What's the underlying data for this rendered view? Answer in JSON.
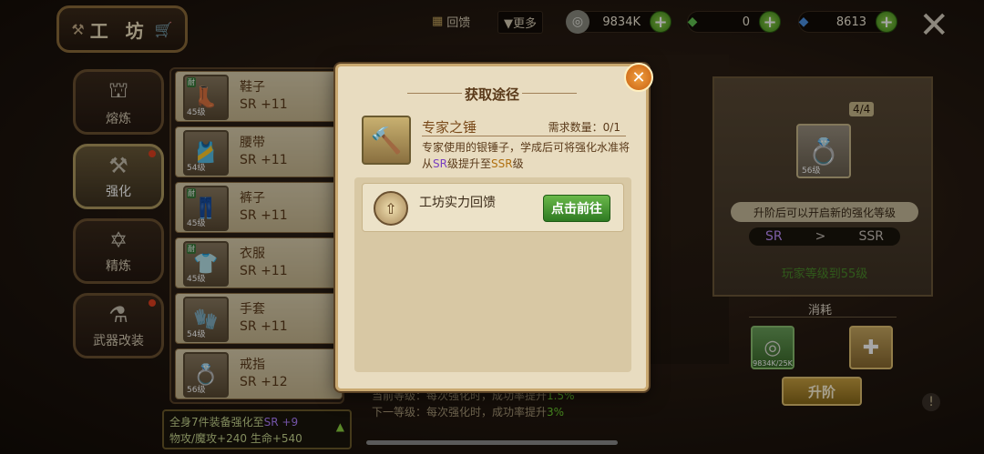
{
  "app": {
    "title": "工 坊"
  },
  "topbar": {
    "feedback_label": "回馈",
    "more_label": "▼更多",
    "currencies": [
      {
        "icon": "silver-coin-icon",
        "value": "9834K"
      },
      {
        "icon": "green-gem-icon",
        "value": "0"
      },
      {
        "icon": "blue-crystal-icon",
        "value": "8613"
      }
    ]
  },
  "nav": [
    {
      "label": "熔炼",
      "icon": "furnace-icon",
      "active": false
    },
    {
      "label": "强化",
      "icon": "anvil-icon",
      "active": true
    },
    {
      "label": "精炼",
      "icon": "star-icon",
      "active": false
    },
    {
      "label": "武器改装",
      "icon": "weapon-mod-icon",
      "active": false
    }
  ],
  "equipment": [
    {
      "name": "鞋子",
      "sr": "SR +11",
      "level": "45级",
      "tag": "耐"
    },
    {
      "name": "腰带",
      "sr": "SR +11",
      "level": "54级",
      "tag": ""
    },
    {
      "name": "裤子",
      "sr": "SR +11",
      "level": "45级",
      "tag": "耐"
    },
    {
      "name": "衣服",
      "sr": "SR +11",
      "level": "45级",
      "tag": "耐"
    },
    {
      "name": "手套",
      "sr": "SR +11",
      "level": "54级",
      "tag": ""
    },
    {
      "name": "戒指",
      "sr": "SR +12",
      "level": "56级",
      "tag": ""
    }
  ],
  "bonus": {
    "line1_prefix": "全身7件装备强化至",
    "line1_sr": "SR +9",
    "line2": "物攻/魔攻+240 生命+540"
  },
  "upgrade": {
    "count": "4/4",
    "ring_level": "56级",
    "hint": "升阶后可以开启新的强化等级",
    "tier_from": "SR",
    "tier_arrow": ">",
    "tier_to": "SSR",
    "requirement": "玩家等级到55级",
    "consume_label": "消耗",
    "consume_qty": "9834K/25K",
    "advance_label": "升阶"
  },
  "stats": {
    "line1_prefix": "当前等级：每次强化时，成功率提升",
    "line1_value": "1.5%",
    "line2_prefix": "下一等级：每次强化时，成功率提升",
    "line2_value": "3%"
  },
  "modal": {
    "title": "获取途径",
    "item_name": "专家之锤",
    "item_count": "需求数量：0/1",
    "desc_a": "专家使用的银锤子，学成后可将强化水准将从",
    "desc_sr": "SR",
    "desc_b": "级提升至",
    "desc_ssr": "SSR",
    "desc_c": "级",
    "source_label": "工坊实力回馈",
    "goto_label": "点击前往"
  }
}
